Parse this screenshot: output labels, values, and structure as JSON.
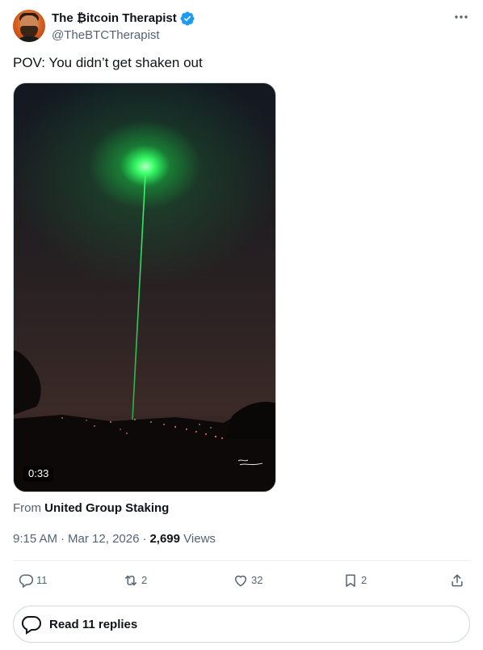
{
  "author": {
    "display_name": "The ₿itcoin Therapist",
    "handle": "@TheBTCTherapist"
  },
  "tweet": {
    "text": "POV: You didn’t get shaken out"
  },
  "media": {
    "duration": "0:33"
  },
  "source": {
    "prefix": "From",
    "name": "United Group Staking"
  },
  "meta": {
    "time": "9:15 AM",
    "separator_1": "·",
    "date": "Mar 12, 2026",
    "separator_2": "·",
    "views_count": "2,699",
    "views_label": "Views"
  },
  "actions": {
    "reply_count": "11",
    "repost_count": "2",
    "like_count": "32",
    "bookmark_count": "2"
  },
  "replies_button": {
    "label": "Read 11 replies"
  },
  "colors": {
    "text_primary": "#0f1419",
    "text_secondary": "#536471",
    "verified_blue": "#1d9bf0",
    "border": "#cfd9de",
    "laser_green": "#2bff5a"
  },
  "icons": [
    "more-icon",
    "verified-badge-icon",
    "reply-icon",
    "repost-icon",
    "like-icon",
    "bookmark-icon",
    "share-icon",
    "replies-bubble-icon"
  ]
}
